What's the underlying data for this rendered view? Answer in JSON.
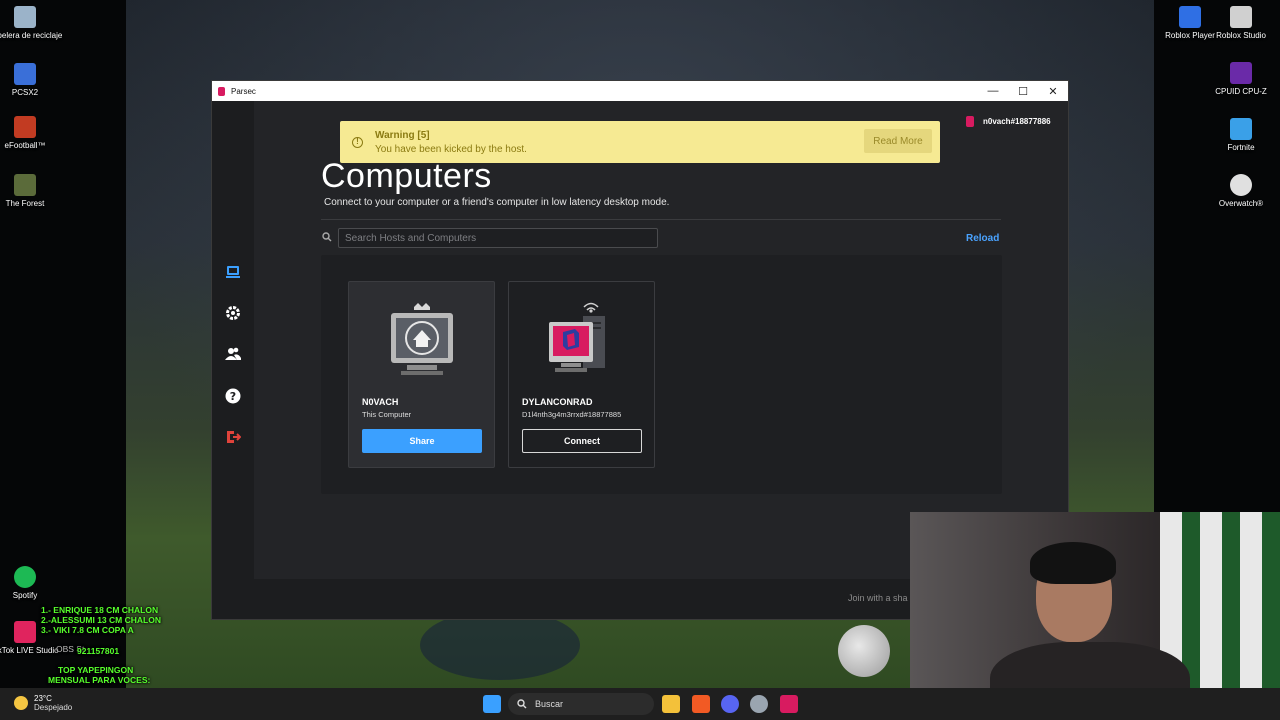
{
  "desktop_left": [
    {
      "label": "Papelera de reciclaje",
      "icon": "recycle-bin-icon",
      "color": "#9bb3c9"
    },
    {
      "label": "PCSX2",
      "icon": "pcsx2-icon",
      "color": "#3a6fd8"
    },
    {
      "label": "eFootball™",
      "icon": "efootball-icon",
      "color": "#c23b22"
    },
    {
      "label": "The Forest",
      "icon": "the-forest-icon",
      "color": "#5b6b3a"
    },
    {
      "label": "Spotify",
      "icon": "spotify-icon",
      "color": "#1db954"
    },
    {
      "label": "TikTok LIVE Studio",
      "icon": "tiktok-live-icon",
      "color": "#e0245e"
    }
  ],
  "desktop_right": [
    {
      "label": "Roblox Player",
      "icon": "roblox-player-icon",
      "color": "#2f6fe4"
    },
    {
      "label": "Roblox Studio",
      "icon": "roblox-studio-icon",
      "color": "#d0d0d0"
    },
    {
      "label": "CPUID CPU-Z",
      "icon": "cpuz-icon",
      "color": "#6a2aa8"
    },
    {
      "label": "Fortnite",
      "icon": "fortnite-icon",
      "color": "#3aa0e8"
    },
    {
      "label": "Overwatch®",
      "icon": "overwatch-icon",
      "color": "#e0e0e0"
    }
  ],
  "window": {
    "title": "Parsec",
    "controls": {
      "minimize": "—",
      "maximize": "☐",
      "close": "✕"
    }
  },
  "sidebar": {
    "items": [
      {
        "name": "computers",
        "icon": "computer-icon",
        "active": true
      },
      {
        "name": "settings",
        "icon": "gear-icon",
        "active": false
      },
      {
        "name": "friends",
        "icon": "users-icon",
        "active": false
      },
      {
        "name": "help",
        "icon": "help-icon",
        "active": false
      },
      {
        "name": "logout",
        "icon": "logout-icon",
        "active": false
      }
    ]
  },
  "warning": {
    "title": "Warning [5]",
    "message": "You have been kicked by the host.",
    "button": "Read More"
  },
  "user": {
    "name": "n0vach#18877886"
  },
  "page": {
    "title": "Computers",
    "subtitle": "Connect to your computer or a friend's computer in low latency desktop mode."
  },
  "search": {
    "placeholder": "Search Hosts and Computers",
    "value": ""
  },
  "reload": "Reload",
  "hosts": [
    {
      "name": "N0VACH",
      "subtitle": "This Computer",
      "button": "Share"
    },
    {
      "name": "DYLANCONRAD",
      "subtitle": "D1l4nth3g4m3rrxd#18877885",
      "button": "Connect"
    }
  ],
  "footer": {
    "join_text": "Join with a sha"
  },
  "stream_overlay": {
    "lines": [
      "1.- ENRIQUE 18 CM CHALON",
      "2.-ALESSUMI 13 CM CHALON",
      "3.- VIKI 7.8 CM COPA A"
    ],
    "number": "921157801",
    "obs": "OBS St",
    "promo": [
      "TOP YAPEPINGON",
      "MENSUAL PARA VOCES:"
    ]
  },
  "taskbar": {
    "temp": "23°C",
    "weather": "Despejado",
    "search": "Buscar",
    "apps": [
      {
        "icon": "windows-start-icon",
        "color": "#3aa0ff"
      },
      {
        "icon": "file-explorer-icon",
        "color": "#f3c13a"
      },
      {
        "icon": "brave-icon",
        "color": "#f25a24"
      },
      {
        "icon": "discord-icon",
        "color": "#5865f2"
      },
      {
        "icon": "steam-icon",
        "color": "#9aa5b0"
      },
      {
        "icon": "parsec-icon",
        "color": "#d81b60"
      }
    ]
  }
}
